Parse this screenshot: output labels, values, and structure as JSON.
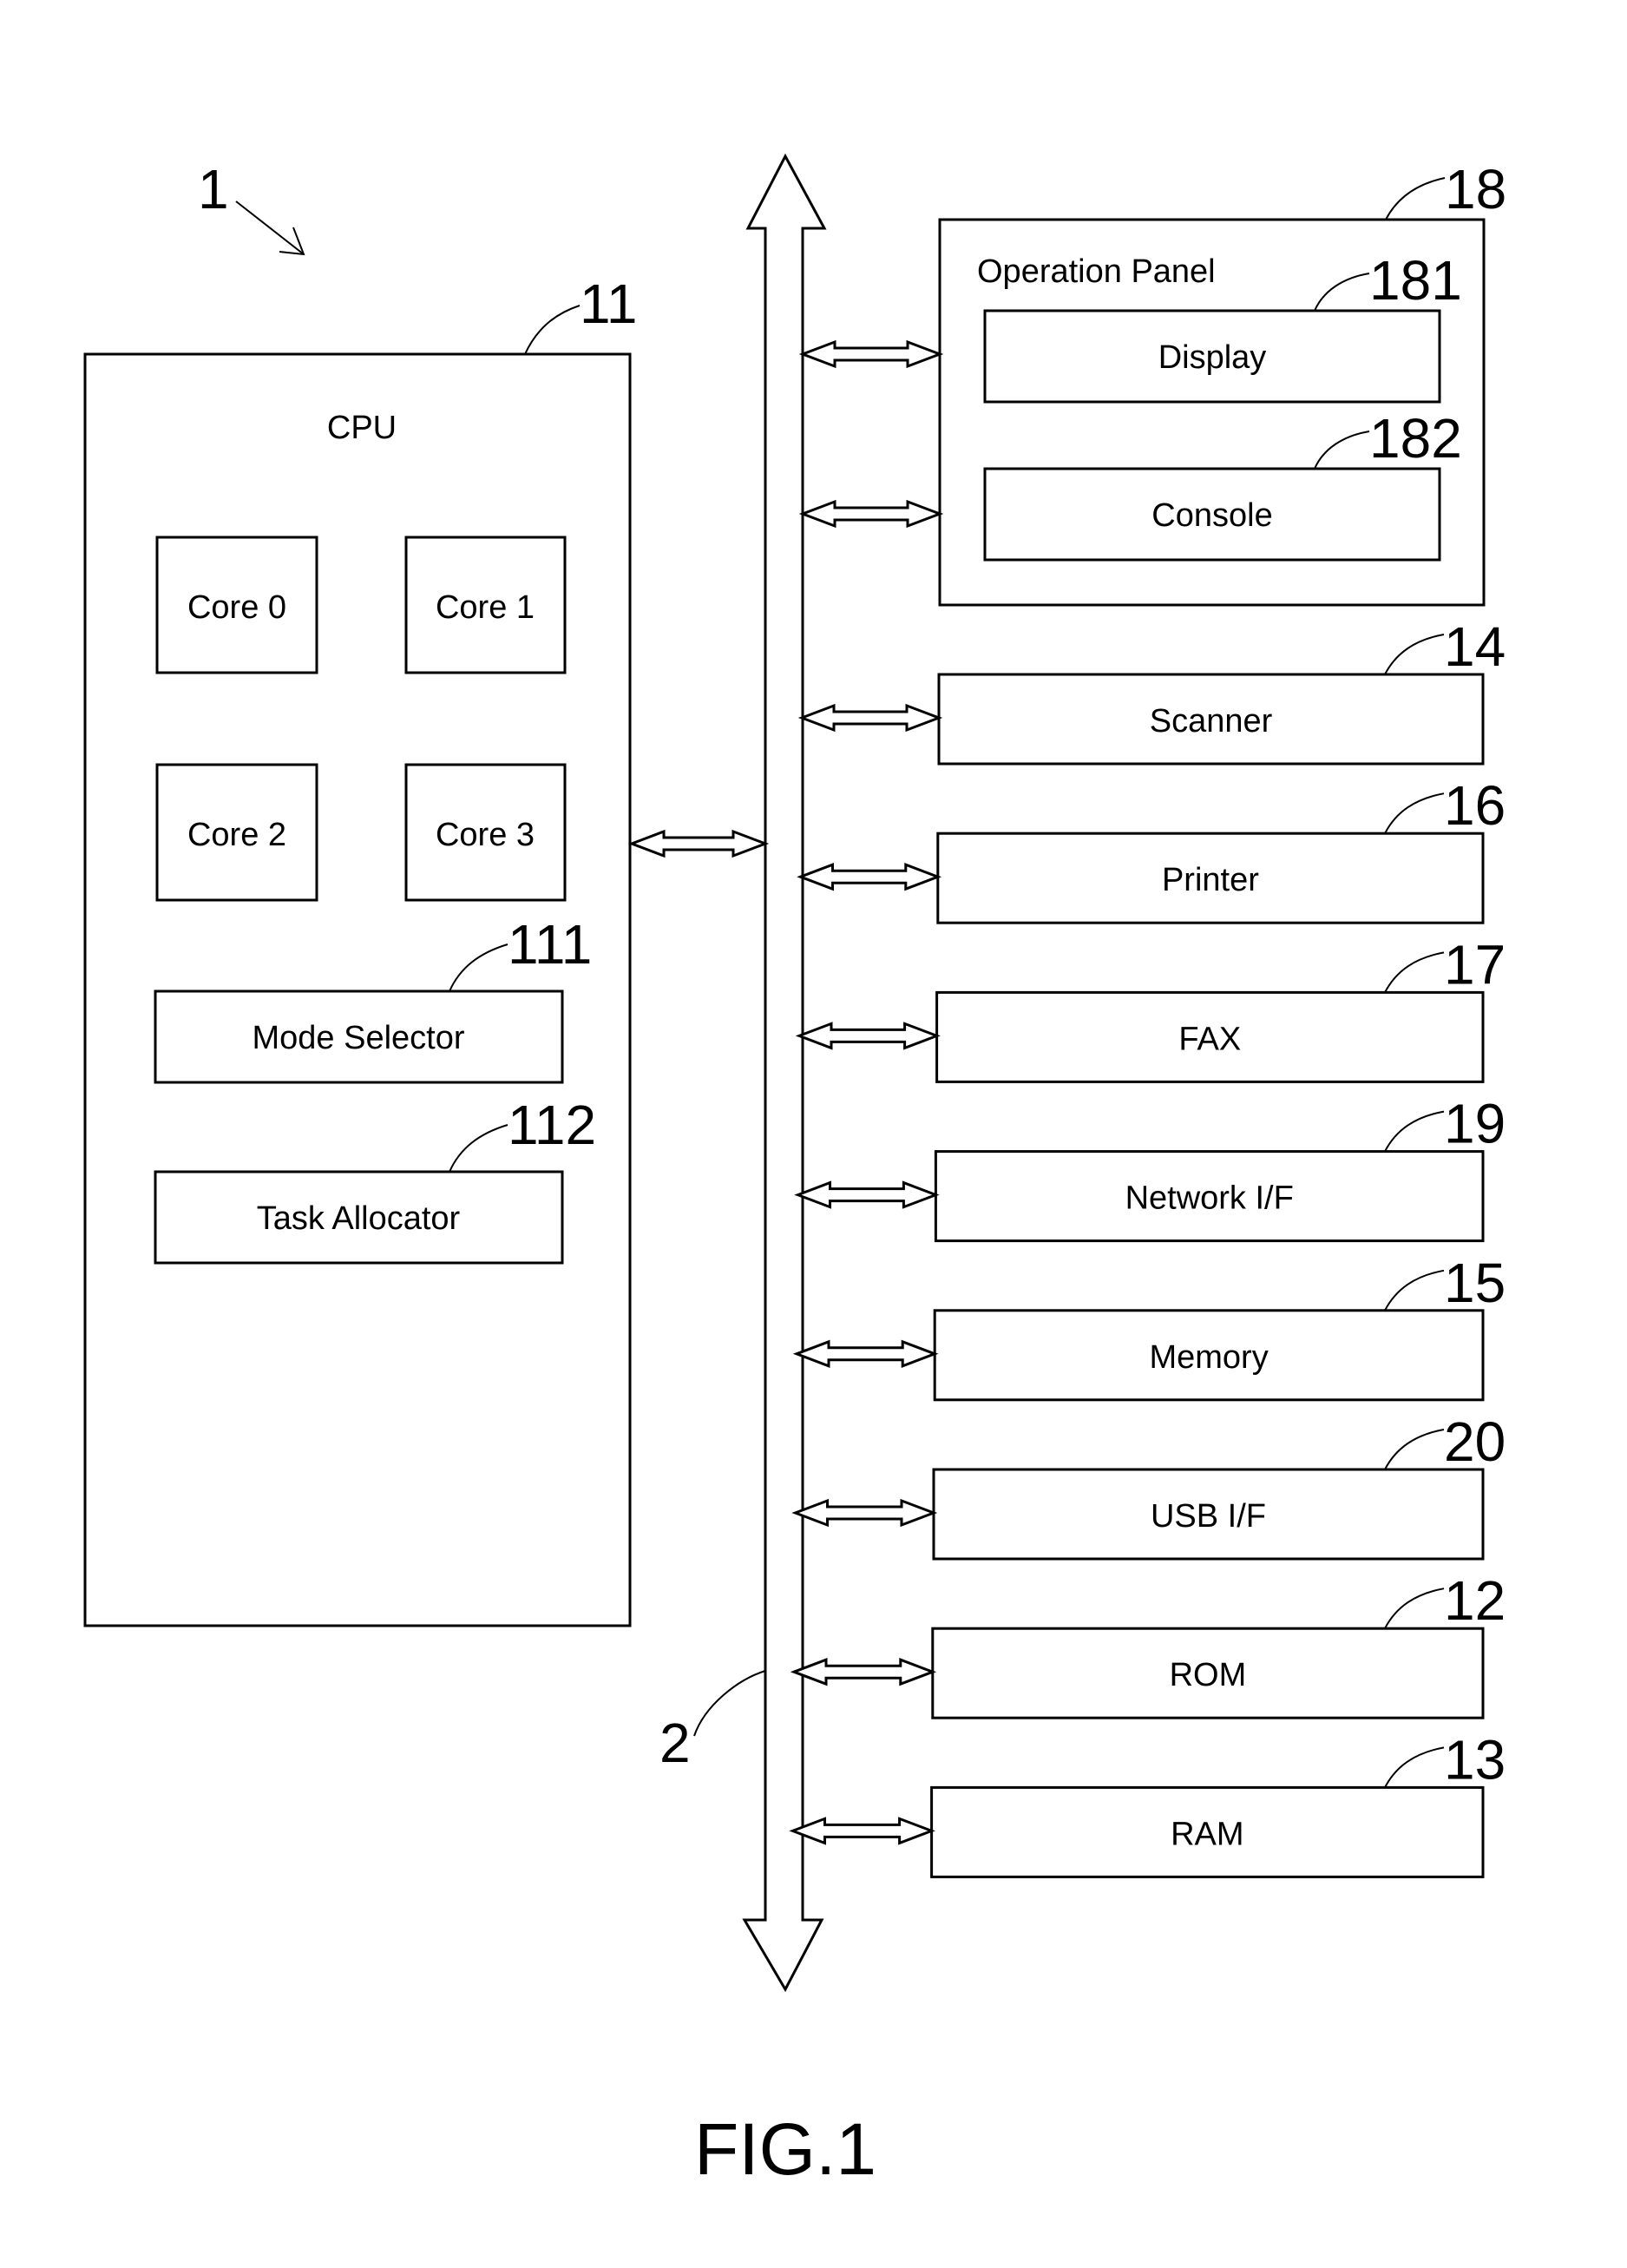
{
  "figure": {
    "caption": "FIG.1",
    "device_ref": "1",
    "bus_ref": "2"
  },
  "cpu": {
    "ref": "11",
    "label": "CPU",
    "cores": [
      "Core 0",
      "Core 1",
      "Core 2",
      "Core 3"
    ],
    "mode_selector": {
      "ref": "111",
      "label": "Mode Selector"
    },
    "task_allocator": {
      "ref": "112",
      "label": "Task Allocator"
    }
  },
  "operation_panel": {
    "ref": "18",
    "label": "Operation Panel",
    "display": {
      "ref": "181",
      "label": "Display"
    },
    "console": {
      "ref": "182",
      "label": "Console"
    }
  },
  "peripherals": [
    {
      "ref": "14",
      "label": "Scanner"
    },
    {
      "ref": "16",
      "label": "Printer"
    },
    {
      "ref": "17",
      "label": "FAX"
    },
    {
      "ref": "19",
      "label": "Network I/F"
    },
    {
      "ref": "15",
      "label": "Memory"
    },
    {
      "ref": "20",
      "label": "USB I/F"
    },
    {
      "ref": "12",
      "label": "ROM"
    },
    {
      "ref": "13",
      "label": "RAM"
    }
  ]
}
